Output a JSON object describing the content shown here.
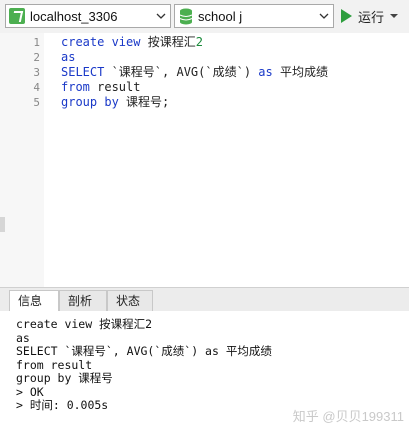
{
  "toolbar": {
    "connection": "localhost_3306",
    "database": "school j",
    "run_label": "运行"
  },
  "editor": {
    "line_numbers": [
      "1",
      "2",
      "3",
      "4",
      "5"
    ],
    "lines": [
      {
        "tokens": [
          {
            "t": "create view ",
            "c": "kw"
          },
          {
            "t": "按课程汇",
            "c": "plain"
          },
          {
            "t": "2",
            "c": "num"
          }
        ]
      },
      {
        "tokens": [
          {
            "t": "as",
            "c": "kw"
          }
        ]
      },
      {
        "tokens": [
          {
            "t": "SELECT ",
            "c": "kw"
          },
          {
            "t": "`课程号`, AVG(`成绩`) ",
            "c": "plain"
          },
          {
            "t": "as ",
            "c": "kw"
          },
          {
            "t": "平均成绩",
            "c": "plain"
          }
        ]
      },
      {
        "tokens": [
          {
            "t": "from ",
            "c": "kw"
          },
          {
            "t": "result",
            "c": "plain"
          }
        ]
      },
      {
        "tokens": [
          {
            "t": "group by ",
            "c": "kw"
          },
          {
            "t": "课程号;",
            "c": "plain"
          }
        ]
      }
    ]
  },
  "tabs": [
    "信息",
    "剖析",
    "状态"
  ],
  "output": {
    "lines": [
      "create view 按课程汇2",
      "as",
      "SELECT `课程号`, AVG(`成绩`) as 平均成绩",
      "from result",
      "group by 课程号",
      "> OK",
      "> 时间: 0.005s"
    ]
  },
  "watermark": "知乎 @贝贝199311",
  "colors": {
    "keyword": "#1a39c8",
    "run": "#2e9e3e",
    "db": "#4caf50"
  }
}
